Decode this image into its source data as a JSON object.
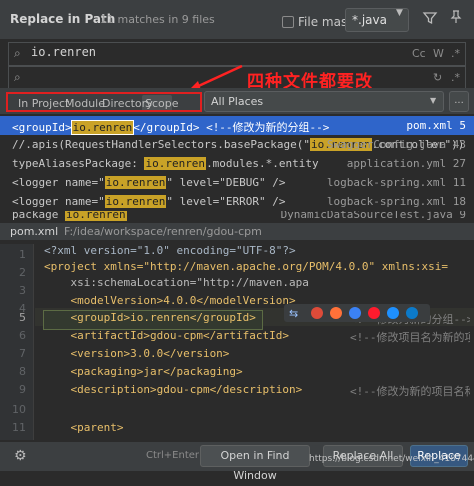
{
  "header": {
    "title": "Replace in Path",
    "matches": "11 matches in 9 files",
    "file_mask_label": "File mask:",
    "file_mask_value": "*.java"
  },
  "search": {
    "query": "io.renren",
    "options": [
      "Cc",
      "W",
      ".*"
    ]
  },
  "annotation": "四种文件都要改",
  "scope": {
    "tabs": [
      "In Project",
      "Module",
      "Directory",
      "Scope"
    ],
    "active": "Scope",
    "places": "All Places",
    "more": "..."
  },
  "results": [
    {
      "pre": "<groupId>",
      "match": "io.renren",
      "post": "</groupId>          <!--修改为新的分组-->",
      "file": "pom.xml 5"
    },
    {
      "pre": "//.apis(RequestHandlerSelectors.basePackage(\"",
      "match": "io.renren",
      "post": ".controller\"))",
      "file": "SwaggerConfig.java 43"
    },
    {
      "pre": "typeAliasesPackage: ",
      "match": "io.renren",
      "post": ".modules.*.entity",
      "file": "application.yml 27"
    },
    {
      "pre": "<logger name=\"",
      "match": "io.renren",
      "post": "\" level=\"DEBUG\" />",
      "file": "logback-spring.xml 11"
    },
    {
      "pre": "<logger name=\"",
      "match": "io.renren",
      "post": "\" level=\"ERROR\" />",
      "file": "logback-spring.xml 18"
    },
    {
      "pre": "package ",
      "match": "io.renren",
      "post": "",
      "file": "DynamicDataSourceTest.java 9"
    }
  ],
  "preview": {
    "file": "pom.xml",
    "path": "F:/idea/workspace/renren/gdou-cpm",
    "lines": [
      {
        "n": "1",
        "text": "<?xml version=\"1.0\" encoding=\"UTF-8\"?>"
      },
      {
        "n": "2",
        "text": "<project xmlns=\"http://maven.apache.org/POM/4.0.0\" xmlns:xsi="
      },
      {
        "n": "3",
        "text": "    xsi:schemaLocation=\"http://maven.apa"
      },
      {
        "n": "4",
        "text": "    <modelVersion>4.0.0</modelVersion>"
      },
      {
        "n": "5",
        "text": "    <groupId>io.renren</groupId>",
        "comment": "<!--修改为新的分组-->"
      },
      {
        "n": "6",
        "text": "    <artifactId>gdou-cpm</artifactId>",
        "comment": "<!--修改项目名为新的项目"
      },
      {
        "n": "7",
        "text": "    <version>3.0.0</version>"
      },
      {
        "n": "8",
        "text": "    <packaging>jar</packaging>"
      },
      {
        "n": "9",
        "text": "    <description>gdou-cpm</description>",
        "comment": "<!--修改为新的项目名称"
      },
      {
        "n": "10",
        "text": ""
      },
      {
        "n": "11",
        "text": "    <parent>"
      }
    ]
  },
  "footer": {
    "shortcut": "Ctrl+Enter",
    "open_label": "Open in Find Window",
    "replace_all_label": "Replace All",
    "replace_label": "Replace",
    "watermark": "https://blog.csdn.net/weixin_41874442"
  },
  "colors": {
    "selection": "#2f65ca",
    "match_highlight": "#c9a227",
    "annotation": "#ff2222",
    "primary_button": "#365880"
  }
}
